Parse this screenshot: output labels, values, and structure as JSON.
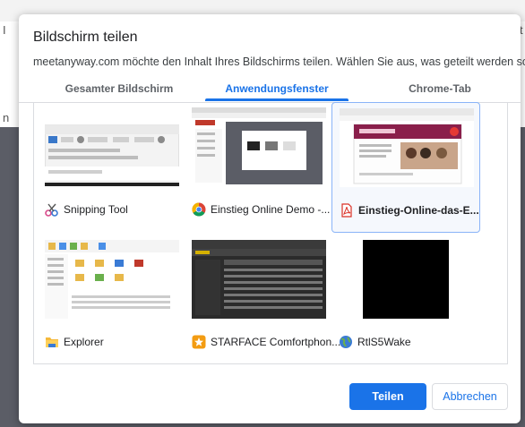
{
  "background": {
    "fragment_left_top": "I",
    "fragment_left_mid": "n",
    "fragment_right_top": "t"
  },
  "dialog": {
    "title": "Bildschirm teilen",
    "subtitle": "meetanyway.com möchte den Inhalt Ihres Bildschirms teilen. Wählen Sie aus, was geteilt werden soll.",
    "tabs": [
      {
        "label": "Gesamter Bildschirm",
        "active": false
      },
      {
        "label": "Anwendungsfenster",
        "active": true
      },
      {
        "label": "Chrome-Tab",
        "active": false
      }
    ],
    "windows": [
      {
        "label": "Snipping Tool",
        "icon": "scissors-icon",
        "selected": false
      },
      {
        "label": "Einstieg Online Demo -...",
        "icon": "chrome-icon",
        "selected": false
      },
      {
        "label": "Einstieg-Online-das-E...",
        "icon": "pdf-icon",
        "selected": true
      },
      {
        "label": "Explorer",
        "icon": "folder-icon",
        "selected": false
      },
      {
        "label": "STARFACE Comfortphon...",
        "icon": "starface-icon",
        "selected": false
      },
      {
        "label": "RtlS5Wake",
        "icon": "globe-icon",
        "selected": false
      }
    ],
    "buttons": {
      "share": "Teilen",
      "cancel": "Abbrechen"
    },
    "colors": {
      "accent": "#1a73e8",
      "selected_border": "#8ab4f8"
    }
  }
}
